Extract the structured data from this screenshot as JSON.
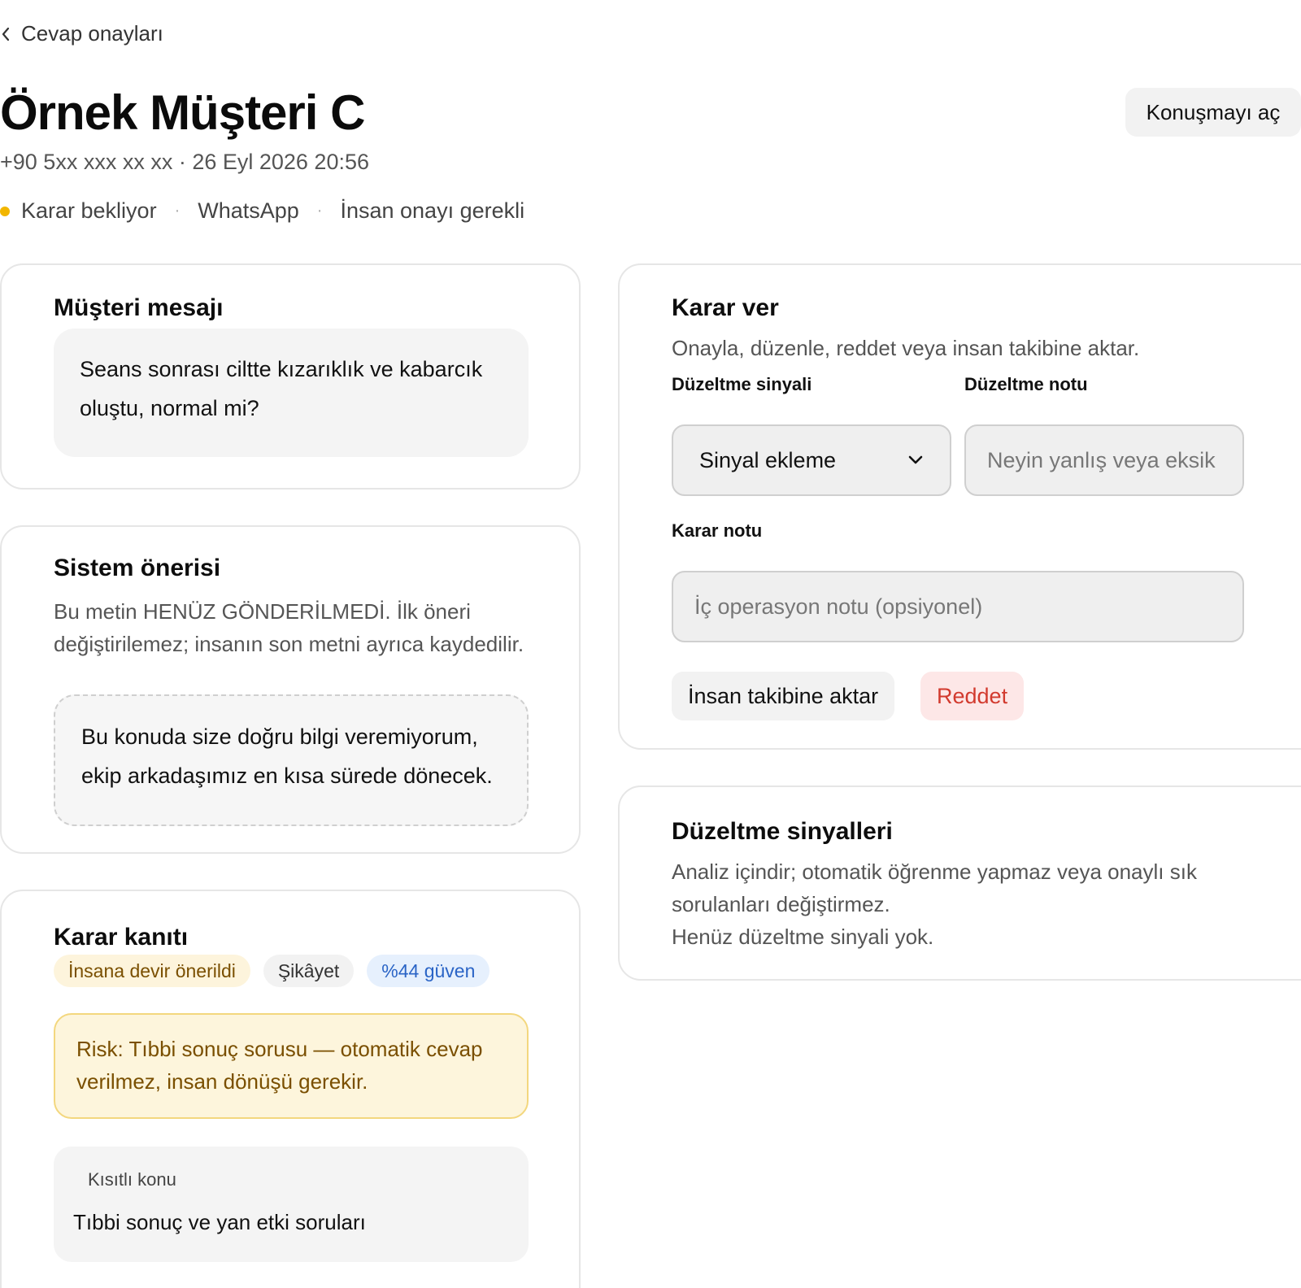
{
  "back": {
    "label": "Cevap onayları"
  },
  "header": {
    "title": "Örnek Müşteri C",
    "meta": "+90 5xx xxx xx xx · 26 Eyl 2026 20:56",
    "status": "Karar bekliyor",
    "channel": "WhatsApp",
    "requirement": "İnsan onayı gerekli",
    "separator": "·",
    "open_button": "Konuşmayı aç"
  },
  "customer_message": {
    "title": "Müşteri mesajı",
    "text": "Seans sonrası ciltte kızarıklık ve kabarcık oluştu, normal mi?"
  },
  "system_suggestion": {
    "title": "Sistem önerisi",
    "note": "Bu metin HENÜZ GÖNDERİLMEDİ. İlk öneri değiştirilemez; insanın son metni ayrıca kaydedilir.",
    "text": "Bu konuda size doğru bilgi veremiyorum, ekip arkadaşımız en kısa sürede dönecek."
  },
  "evidence": {
    "title": "Karar kanıtı",
    "chips": {
      "handoff": "İnsana devir önerildi",
      "category": "Şikâyet",
      "confidence": "%44 güven"
    },
    "risk": "Risk: Tıbbi sonuç sorusu — otomatik cevap verilmez, insan dönüşü gerekir.",
    "restricted_label": "Kısıtlı konu",
    "restricted_value": "Tıbbi sonuç ve yan etki soruları"
  },
  "decision": {
    "title": "Karar ver",
    "subtitle": "Onayla, düzenle, reddet veya insan takibine aktar.",
    "signal_label": "Düzeltme sinyali",
    "signal_value": "Sinyal ekleme",
    "note_label": "Düzeltme notu",
    "note_placeholder": "Neyin yanlış veya eksik",
    "decision_note_label": "Karar notu",
    "decision_note_placeholder": "İç operasyon notu (opsiyonel)",
    "handoff_button": "İnsan takibine aktar",
    "reject_button": "Reddet"
  },
  "signals": {
    "title": "Düzeltme sinyalleri",
    "description": "Analiz içindir; otomatik öğrenme yapmaz veya onaylı sık sorulanları değiştirmez.",
    "empty": "Henüz düzeltme sinyali yok."
  },
  "colors": {
    "status_dot": "#f2b600",
    "reject": "#d23a2e",
    "confidence": "#2a64c6",
    "risk": "#7a4f00"
  }
}
